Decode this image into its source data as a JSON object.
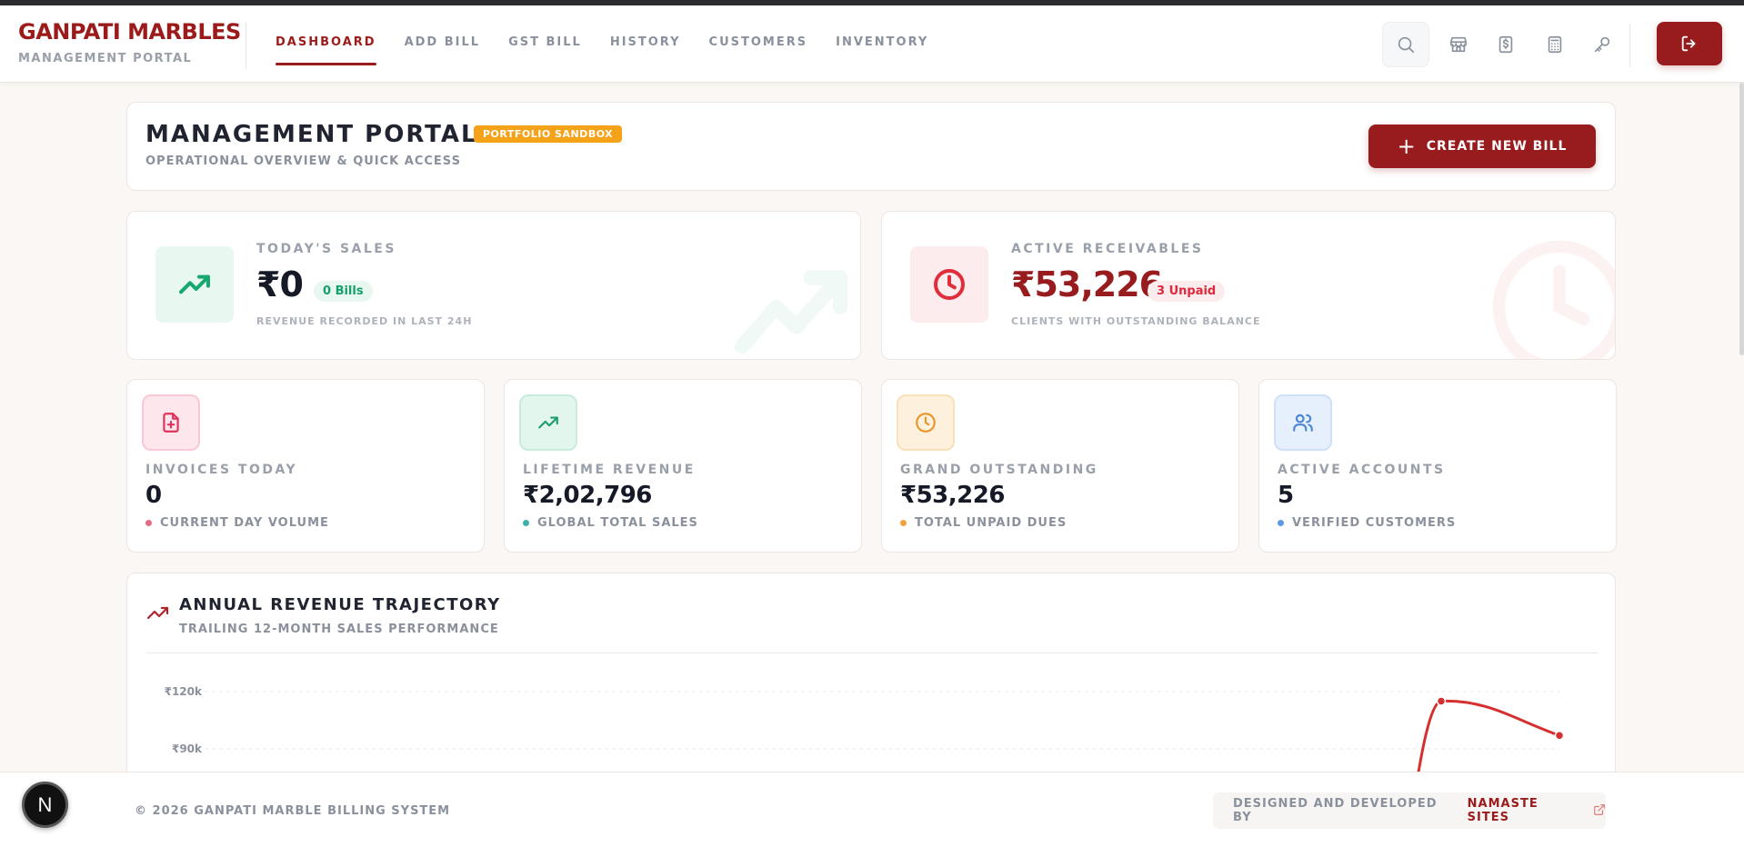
{
  "brand": {
    "name": "GANPATI MARBLES",
    "subtitle": "MANAGEMENT PORTAL"
  },
  "nav": {
    "items": [
      {
        "label": "DASHBOARD",
        "active": true
      },
      {
        "label": "ADD BILL",
        "active": false
      },
      {
        "label": "GST BILL",
        "active": false
      },
      {
        "label": "HISTORY",
        "active": false
      },
      {
        "label": "CUSTOMERS",
        "active": false
      },
      {
        "label": "INVENTORY",
        "active": false
      }
    ]
  },
  "toolbar": {
    "icons": [
      "search-icon",
      "store-icon",
      "currency-receipt-icon",
      "calculator-icon",
      "key-icon"
    ],
    "logout_icon": "logout-icon"
  },
  "portal": {
    "title": "MANAGEMENT PORTAL",
    "badge": "PORTFOLIO SANDBOX",
    "subtitle": "OPERATIONAL OVERVIEW & QUICK ACCESS",
    "create_plus": "+",
    "create_label": "CREATE NEW BILL"
  },
  "todays_sales": {
    "label": "TODAY'S SALES",
    "value": "₹0",
    "pill": "0 Bills",
    "caption": "REVENUE RECORDED IN LAST 24H"
  },
  "receivables": {
    "label": "ACTIVE RECEIVABLES",
    "value": "₹53,226",
    "pill": "3 Unpaid",
    "caption": "CLIENTS WITH OUTSTANDING BALANCE"
  },
  "stats": [
    {
      "label": "INVOICES TODAY",
      "value": "0",
      "caption": "CURRENT DAY VOLUME",
      "icon": "file-plus-icon",
      "color": "#e36b86"
    },
    {
      "label": "LIFETIME REVENUE",
      "value": "₹2,02,796",
      "caption": "GLOBAL TOTAL SALES",
      "icon": "trending-up-icon",
      "color": "#3bb08f"
    },
    {
      "label": "GRAND OUTSTANDING",
      "value": "₹53,226",
      "caption": "TOTAL UNPAID DUES",
      "icon": "clock-icon",
      "color": "#f2a33a"
    },
    {
      "label": "ACTIVE ACCOUNTS",
      "value": "5",
      "caption": "VERIFIED CUSTOMERS",
      "icon": "users-icon",
      "color": "#5b9ae0"
    }
  ],
  "chart": {
    "title": "ANNUAL REVENUE TRAJECTORY",
    "subtitle": "TRAILING 12-MONTH SALES PERFORMANCE"
  },
  "chart_data": {
    "type": "line",
    "y_tick_labels": [
      "₹120k",
      "₹90k"
    ],
    "y_ticks": [
      120000,
      90000
    ],
    "series_color": "#d62f2f",
    "visible_points": [
      {
        "index": 10,
        "y": 115000
      },
      {
        "index": 11,
        "y": 97000
      }
    ],
    "point_count": 12,
    "ylim": [
      0,
      130000
    ]
  },
  "footer": {
    "copyright": "© 2026 GANPATI MARBLE BILLING SYSTEM",
    "credit_label": "DESIGNED AND DEVELOPED BY",
    "credit_link": "NAMASTE SITES"
  },
  "dev_badge": "N"
}
